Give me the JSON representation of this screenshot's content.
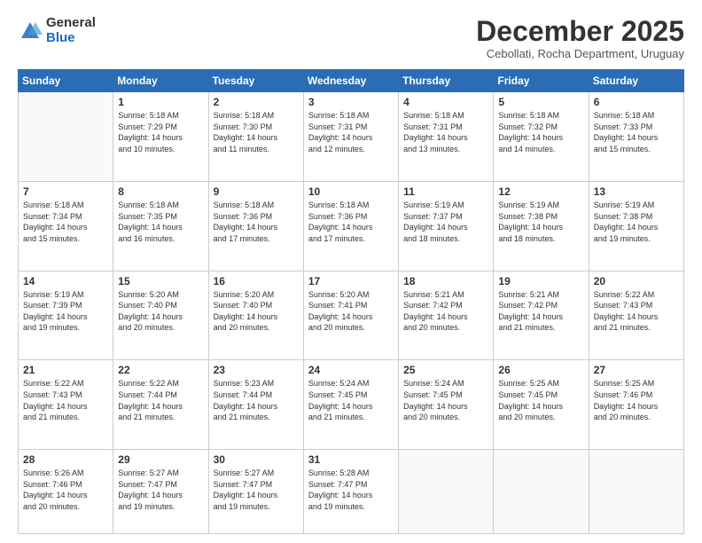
{
  "logo": {
    "general": "General",
    "blue": "Blue"
  },
  "header": {
    "month": "December 2025",
    "location": "Cebollati, Rocha Department, Uruguay"
  },
  "weekdays": [
    "Sunday",
    "Monday",
    "Tuesday",
    "Wednesday",
    "Thursday",
    "Friday",
    "Saturday"
  ],
  "weeks": [
    [
      {
        "day": "",
        "info": ""
      },
      {
        "day": "1",
        "info": "Sunrise: 5:18 AM\nSunset: 7:29 PM\nDaylight: 14 hours\nand 10 minutes."
      },
      {
        "day": "2",
        "info": "Sunrise: 5:18 AM\nSunset: 7:30 PM\nDaylight: 14 hours\nand 11 minutes."
      },
      {
        "day": "3",
        "info": "Sunrise: 5:18 AM\nSunset: 7:31 PM\nDaylight: 14 hours\nand 12 minutes."
      },
      {
        "day": "4",
        "info": "Sunrise: 5:18 AM\nSunset: 7:31 PM\nDaylight: 14 hours\nand 13 minutes."
      },
      {
        "day": "5",
        "info": "Sunrise: 5:18 AM\nSunset: 7:32 PM\nDaylight: 14 hours\nand 14 minutes."
      },
      {
        "day": "6",
        "info": "Sunrise: 5:18 AM\nSunset: 7:33 PM\nDaylight: 14 hours\nand 15 minutes."
      }
    ],
    [
      {
        "day": "7",
        "info": "Sunrise: 5:18 AM\nSunset: 7:34 PM\nDaylight: 14 hours\nand 15 minutes."
      },
      {
        "day": "8",
        "info": "Sunrise: 5:18 AM\nSunset: 7:35 PM\nDaylight: 14 hours\nand 16 minutes."
      },
      {
        "day": "9",
        "info": "Sunrise: 5:18 AM\nSunset: 7:36 PM\nDaylight: 14 hours\nand 17 minutes."
      },
      {
        "day": "10",
        "info": "Sunrise: 5:18 AM\nSunset: 7:36 PM\nDaylight: 14 hours\nand 17 minutes."
      },
      {
        "day": "11",
        "info": "Sunrise: 5:19 AM\nSunset: 7:37 PM\nDaylight: 14 hours\nand 18 minutes."
      },
      {
        "day": "12",
        "info": "Sunrise: 5:19 AM\nSunset: 7:38 PM\nDaylight: 14 hours\nand 18 minutes."
      },
      {
        "day": "13",
        "info": "Sunrise: 5:19 AM\nSunset: 7:38 PM\nDaylight: 14 hours\nand 19 minutes."
      }
    ],
    [
      {
        "day": "14",
        "info": "Sunrise: 5:19 AM\nSunset: 7:39 PM\nDaylight: 14 hours\nand 19 minutes."
      },
      {
        "day": "15",
        "info": "Sunrise: 5:20 AM\nSunset: 7:40 PM\nDaylight: 14 hours\nand 20 minutes."
      },
      {
        "day": "16",
        "info": "Sunrise: 5:20 AM\nSunset: 7:40 PM\nDaylight: 14 hours\nand 20 minutes."
      },
      {
        "day": "17",
        "info": "Sunrise: 5:20 AM\nSunset: 7:41 PM\nDaylight: 14 hours\nand 20 minutes."
      },
      {
        "day": "18",
        "info": "Sunrise: 5:21 AM\nSunset: 7:42 PM\nDaylight: 14 hours\nand 20 minutes."
      },
      {
        "day": "19",
        "info": "Sunrise: 5:21 AM\nSunset: 7:42 PM\nDaylight: 14 hours\nand 21 minutes."
      },
      {
        "day": "20",
        "info": "Sunrise: 5:22 AM\nSunset: 7:43 PM\nDaylight: 14 hours\nand 21 minutes."
      }
    ],
    [
      {
        "day": "21",
        "info": "Sunrise: 5:22 AM\nSunset: 7:43 PM\nDaylight: 14 hours\nand 21 minutes."
      },
      {
        "day": "22",
        "info": "Sunrise: 5:22 AM\nSunset: 7:44 PM\nDaylight: 14 hours\nand 21 minutes."
      },
      {
        "day": "23",
        "info": "Sunrise: 5:23 AM\nSunset: 7:44 PM\nDaylight: 14 hours\nand 21 minutes."
      },
      {
        "day": "24",
        "info": "Sunrise: 5:24 AM\nSunset: 7:45 PM\nDaylight: 14 hours\nand 21 minutes."
      },
      {
        "day": "25",
        "info": "Sunrise: 5:24 AM\nSunset: 7:45 PM\nDaylight: 14 hours\nand 20 minutes."
      },
      {
        "day": "26",
        "info": "Sunrise: 5:25 AM\nSunset: 7:45 PM\nDaylight: 14 hours\nand 20 minutes."
      },
      {
        "day": "27",
        "info": "Sunrise: 5:25 AM\nSunset: 7:46 PM\nDaylight: 14 hours\nand 20 minutes."
      }
    ],
    [
      {
        "day": "28",
        "info": "Sunrise: 5:26 AM\nSunset: 7:46 PM\nDaylight: 14 hours\nand 20 minutes."
      },
      {
        "day": "29",
        "info": "Sunrise: 5:27 AM\nSunset: 7:47 PM\nDaylight: 14 hours\nand 19 minutes."
      },
      {
        "day": "30",
        "info": "Sunrise: 5:27 AM\nSunset: 7:47 PM\nDaylight: 14 hours\nand 19 minutes."
      },
      {
        "day": "31",
        "info": "Sunrise: 5:28 AM\nSunset: 7:47 PM\nDaylight: 14 hours\nand 19 minutes."
      },
      {
        "day": "",
        "info": ""
      },
      {
        "day": "",
        "info": ""
      },
      {
        "day": "",
        "info": ""
      }
    ]
  ]
}
